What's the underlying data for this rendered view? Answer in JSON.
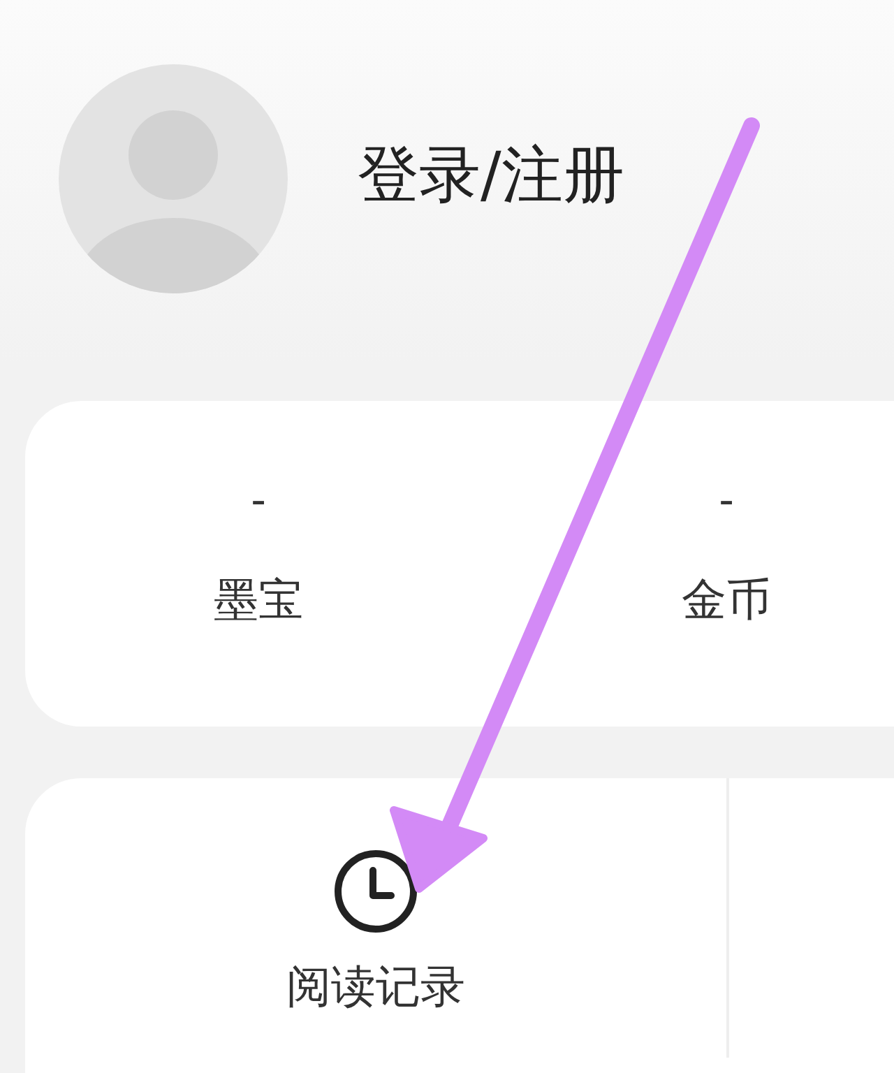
{
  "header": {
    "title": "登录/注册"
  },
  "stats": [
    {
      "value": "-",
      "label": "墨宝"
    },
    {
      "value": "-",
      "label": "金币"
    }
  ],
  "shortcuts": [
    {
      "label": "阅读记录"
    }
  ]
}
